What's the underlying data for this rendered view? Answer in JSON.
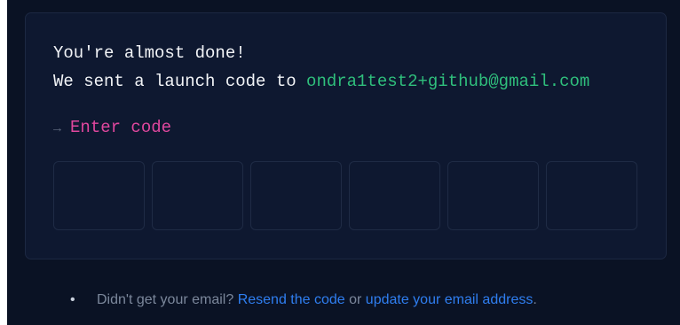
{
  "confirm": {
    "title": "You're almost done!",
    "sent_prefix": "We sent a launch code to ",
    "email": "ondra1test2+github@gmail.com",
    "prompt_arrow": "→",
    "prompt_label": "Enter code",
    "code_digits": [
      "",
      "",
      "",
      "",
      "",
      ""
    ]
  },
  "footer": {
    "bullet": "•",
    "question": "Didn't get your email? ",
    "resend_link": "Resend the code",
    "or_text": " or ",
    "update_link": "update your email address",
    "end_punct": "."
  }
}
